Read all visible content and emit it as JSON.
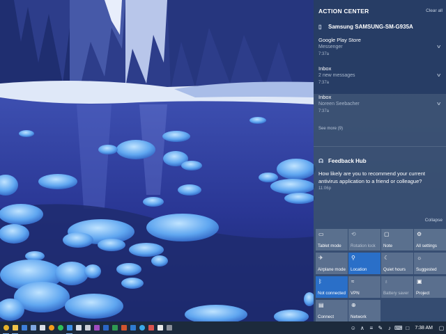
{
  "action_center": {
    "header": "ACTION CENTER",
    "clear_all": "Clear all",
    "device_group": "Samsung SAMSUNG-SM-G935A",
    "notifications": [
      {
        "title": "Google Play Store",
        "body": "Messenger",
        "time": "7:37a"
      },
      {
        "title": "Inbox",
        "body": "2 new messages",
        "time": "7:37a"
      },
      {
        "title": "Inbox",
        "body": "Noreen Seebacher",
        "time": "7:37a"
      }
    ],
    "see_more": "See more (9)",
    "feedback": {
      "app": "Feedback Hub",
      "body": "How likely are you to recommend your current antivirus application to a friend or colleague?",
      "time": "11:06p"
    },
    "collapse": "Collapse",
    "quick_actions": [
      {
        "label": "Tablet mode",
        "icon": "tablet-icon",
        "state": "off"
      },
      {
        "label": "Rotation lock",
        "icon": "rotation-lock-icon",
        "state": "disabled"
      },
      {
        "label": "Note",
        "icon": "note-icon",
        "state": "off"
      },
      {
        "label": "All settings",
        "icon": "gear-icon",
        "state": "off"
      },
      {
        "label": "Airplane mode",
        "icon": "airplane-icon",
        "state": "off"
      },
      {
        "label": "Location",
        "icon": "location-icon",
        "state": "on"
      },
      {
        "label": "Quiet hours",
        "icon": "moon-icon",
        "state": "off"
      },
      {
        "label": "Suggested",
        "icon": "bulb-icon",
        "state": "off"
      },
      {
        "label": "Not connected",
        "icon": "bluetooth-icon",
        "state": "on"
      },
      {
        "label": "VPN",
        "icon": "vpn-icon",
        "state": "off"
      },
      {
        "label": "Battery saver",
        "icon": "battery-saver-icon",
        "state": "disabled"
      },
      {
        "label": "Project",
        "icon": "project-icon",
        "state": "off"
      },
      {
        "label": "Connect",
        "icon": "connect-icon",
        "state": "off"
      },
      {
        "label": "Network",
        "icon": "network-icon",
        "state": "off"
      }
    ]
  },
  "taskbar": {
    "time": "7:38 AM",
    "apps": [
      {
        "name": "chrome-icon",
        "color": "#e8b32a"
      },
      {
        "name": "explorer-icon",
        "color": "#f0c24a"
      },
      {
        "name": "word-doc-icon",
        "color": "#3f7fd8"
      },
      {
        "name": "notes-icon",
        "color": "#7fa7e0"
      },
      {
        "name": "document-icon",
        "color": "#d8dde6"
      },
      {
        "name": "audible-icon",
        "color": "#f29b1c"
      },
      {
        "name": "spotify-icon",
        "color": "#2ec05a"
      },
      {
        "name": "edge-icon",
        "color": "#3a8ee6"
      },
      {
        "name": "mail-icon",
        "color": "#d8dde6"
      },
      {
        "name": "store-icon",
        "color": "#c9cdd6"
      },
      {
        "name": "onenote-icon",
        "color": "#a04cc0"
      },
      {
        "name": "word-icon",
        "color": "#2b66c4"
      },
      {
        "name": "excel-icon",
        "color": "#2f9a52"
      },
      {
        "name": "powerpoint-icon",
        "color": "#d0552f"
      },
      {
        "name": "outlook-icon",
        "color": "#2f7bd0"
      },
      {
        "name": "skype-icon",
        "color": "#3aa8e8"
      },
      {
        "name": "photos-icon",
        "color": "#d9534f"
      },
      {
        "name": "groove-icon",
        "color": "#e8e8e8"
      },
      {
        "name": "calculator-icon",
        "color": "#8a8f99"
      }
    ],
    "tray": [
      {
        "name": "people-icon",
        "glyph": "☺"
      },
      {
        "name": "chevron-up-icon",
        "glyph": "∧"
      },
      {
        "name": "network-tray-icon",
        "glyph": "≡"
      },
      {
        "name": "pen-icon",
        "glyph": "✎"
      },
      {
        "name": "volume-icon",
        "glyph": "♪"
      },
      {
        "name": "keyboard-icon",
        "glyph": "⌨"
      },
      {
        "name": "notification-icon",
        "glyph": "□"
      }
    ]
  }
}
